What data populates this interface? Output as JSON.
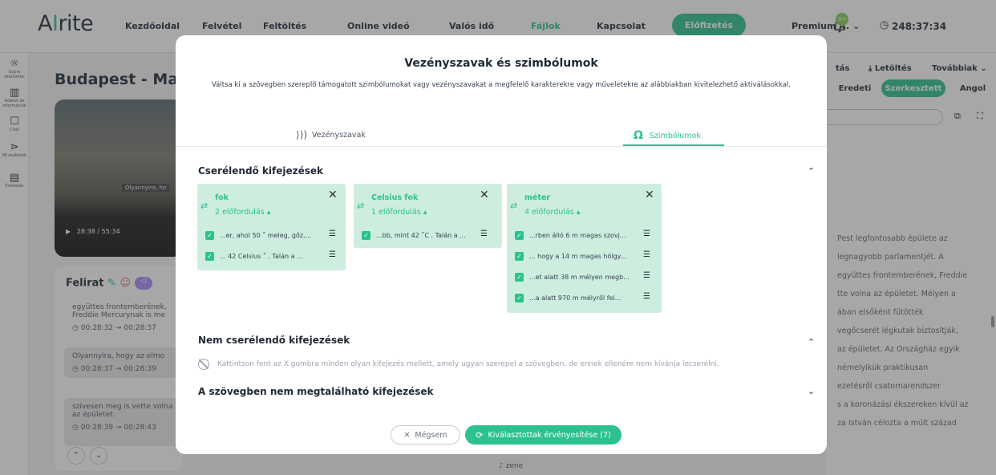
{
  "app": {
    "logo_a": "A",
    "logo_i": "I",
    "logo_rest": "rite",
    "nav": [
      "Kezdőoldal",
      "Felvétel",
      "Feltöltés",
      "Online videó",
      "Valós idő",
      "Fájlok",
      "Kapcsolat"
    ],
    "subscribe": "Előfizetés",
    "premium": "Premium A. ⌄",
    "bell_badge": "9+",
    "timer": "248:37:34"
  },
  "leftrail": [
    {
      "label": "Gyors áttekintés",
      "icon": "lightbulb-icon"
    },
    {
      "label": "Adatok és információk",
      "icon": "stats-icon"
    },
    {
      "label": "Chat",
      "icon": "chat-icon"
    },
    {
      "label": "MI eszközök",
      "icon": "ai-tools-icon"
    },
    {
      "label": "Értékelés",
      "icon": "rating-icon"
    }
  ],
  "background": {
    "page_title": "Budapest - Magy",
    "video_subtitle": "Olyannyira, ho",
    "video_time": "28:38 / 55:34",
    "felirat_title": "Felirat",
    "subtitles": [
      {
        "text1": "együttes frontemberének,",
        "text2": "Freddie Mercurynak is me",
        "time": "00:28:32 → 00:28:37"
      },
      {
        "text1": "Olyannyira, hogy az elmo",
        "text2": "",
        "time": "00:28:37 → 00:28:39"
      },
      {
        "text1": "szívesen meg is vette volna",
        "text2": "az épületet.",
        "time": "00:28:39 → 00:28:43"
      }
    ],
    "right_top": [
      "tás",
      "Letöltés",
      "Továbbiak ⌄"
    ],
    "right_tabs": [
      "Eredeti",
      "Szerkesztett",
      "Angol"
    ],
    "right_text": [
      "Pest legfontosabb épülete az",
      "legnagyobb parlamentjét. A",
      "együttes frontemberének, Freddie",
      "tte volna az épületet. Mélyen a",
      "ában elsőként fűtötték",
      "vegőcserét légkutak biztosítják,",
      "az épületet. Az Országház egyik",
      "némelyikük praktikusan",
      "ezetésről csatornarendszer",
      "s a koronázási ékszereken kívül az",
      "za István célozta a múlt század"
    ],
    "bottom_label": "zene"
  },
  "modal": {
    "title": "Vezényszavak és szimbólumok",
    "description": "Váltsa ki a szövegben szereplő támogatott szimbólumokat vagy vezényszavakat a megfelelő karakterekre vagy műveletekre az alábbiakban kivitelezhető aktiválásokkal.",
    "tab_commands": "Vezényszavak",
    "tab_symbols": "Szimbólumok",
    "section_replace": "Cserélendő kifejezések",
    "section_keep": "Nem cserélendő kifejezések",
    "keep_hint": "Kattintson fent az X gombra minden olyan kifejezés mellett, amely ugyan szerepel a szövegben, de ennek ellenére nem kívánja lecserélni.",
    "section_notfound": "A szövegben nem megtalálható kifejezések",
    "cards": [
      {
        "name": "fok",
        "count": "2 előfordulás ▴",
        "occurrences": [
          "...er, ahol 50 ˚ meleg, gőz,...",
          "... 42 Celsius ˚ . Talán a ..."
        ]
      },
      {
        "name": "Celsius fok",
        "count": "1 előfordulás ▴",
        "occurrences": [
          "...bb, mint 42 ˚C . Talán a ..."
        ]
      },
      {
        "name": "méter",
        "count": "4 előfordulás ▴",
        "occurrences": [
          "...rben álló 6 m magas szovj...",
          "... hogy a 14 m magas hölgy...",
          "...et alatt 38 m mélyen megb...",
          "...a alatt 970 m mélyről fel..."
        ]
      }
    ],
    "cancel": "Mégsem",
    "apply": "Kiválasztottak érvényesítése (7)"
  }
}
